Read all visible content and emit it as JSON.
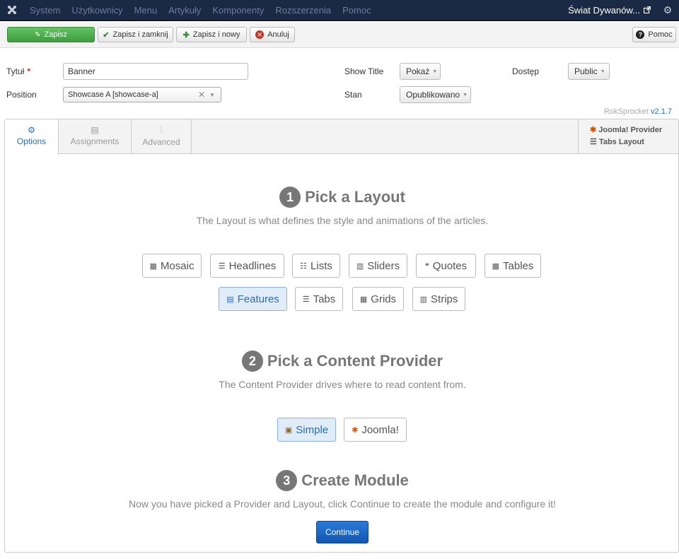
{
  "navbar": {
    "menu": [
      "System",
      "Użytkownicy",
      "Menu",
      "Artykuły",
      "Komponenty",
      "Rozszerzenia",
      "Pomoc"
    ],
    "site_name": "Świat Dywanów...",
    "logo_icon": "joomla-icon",
    "settings_icon": "gear-icon"
  },
  "toolbar": {
    "save": "Zapisz",
    "save_close": "Zapisz i zamknij",
    "save_new": "Zapisz i nowy",
    "cancel": "Anuluj",
    "help": "Pomoc"
  },
  "form": {
    "title_label": "Tytuł",
    "title_value": "Banner",
    "position_label": "Position",
    "position_value": "Showcase A [showcase-a]",
    "show_title_label": "Show Title",
    "show_title_value": "Pokaż",
    "status_label": "Stan",
    "status_value": "Opublikowano",
    "access_label": "Dostęp",
    "access_value": "Public"
  },
  "version": {
    "name": "RokSprocket",
    "number": "v2.1.7"
  },
  "tabs": [
    {
      "label": "Options",
      "icon": "gear-icon"
    },
    {
      "label": "Assignments",
      "icon": "assignments-icon"
    },
    {
      "label": "Advanced",
      "icon": "sliders-icon"
    }
  ],
  "provider_box": {
    "provider": "Joomla! Provider",
    "layout": "Tabs Layout"
  },
  "step1": {
    "number": "1",
    "title": "Pick a Layout",
    "subtitle": "The Layout is what defines the style and animations of the articles.",
    "row1": [
      "Mosaic",
      "Headlines",
      "Lists",
      "Sliders",
      "Quotes",
      "Tables"
    ],
    "row2": [
      "Features",
      "Tabs",
      "Grids",
      "Strips"
    ],
    "selected": "Features"
  },
  "step2": {
    "number": "2",
    "title": "Pick a Content Provider",
    "subtitle": "The Content Provider drives where to read content from.",
    "options": [
      "Simple",
      "Joomla!"
    ],
    "selected": "Simple"
  },
  "step3": {
    "number": "3",
    "title": "Create Module",
    "subtitle": "Now you have picked a Provider and Layout, click Continue to create the module and configure it!",
    "continue": "Continue"
  },
  "colors": {
    "navbar": "#1a2a45",
    "save_green": "#4cae4c",
    "accent_blue": "#2a6fb5",
    "selected_bg": "#e0ecf8"
  }
}
